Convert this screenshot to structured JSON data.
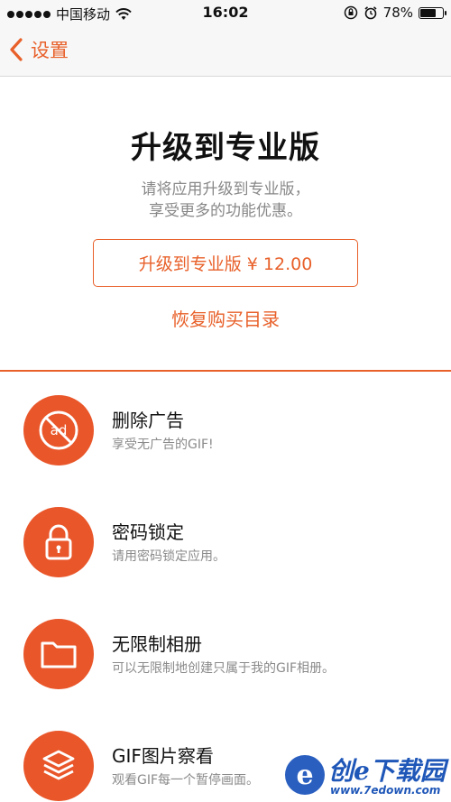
{
  "status_bar": {
    "carrier": "中国移动",
    "time": "16:02",
    "battery_percent": "78%",
    "battery_level": 0.78
  },
  "nav": {
    "back_label": "设置",
    "accent_color": "#e8602a"
  },
  "upgrade": {
    "title": "升级到专业版",
    "desc_line1": "请将应用升级到专业版，",
    "desc_line2": "享受更多的功能优惠。",
    "purchase_label": "升级到专业版 ¥ 12.00",
    "restore_label": "恢复购买目录"
  },
  "features": [
    {
      "icon": "no-ads-icon",
      "title": "删除广告",
      "desc": "享受无广告的GIF!"
    },
    {
      "icon": "lock-icon",
      "title": "密码锁定",
      "desc": "请用密码锁定应用。"
    },
    {
      "icon": "folder-icon",
      "title": "无限制相册",
      "desc": "可以无限制地创建只属于我的GIF相册。"
    },
    {
      "icon": "layers-icon",
      "title": "GIF图片察看",
      "desc": "观看GIF每一个暂停画面。"
    }
  ],
  "watermark": {
    "text": "创e下载园",
    "url": "www.7edown.com"
  }
}
